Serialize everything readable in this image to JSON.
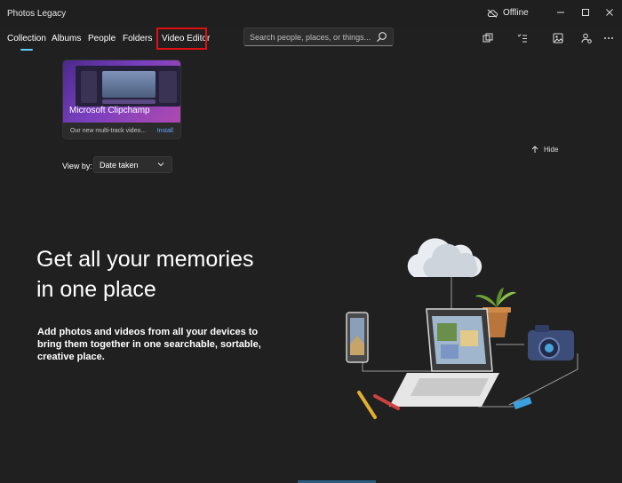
{
  "window": {
    "title": "Photos Legacy",
    "offline_label": "Offline"
  },
  "nav": {
    "tabs": [
      {
        "label": "Collection",
        "active": true
      },
      {
        "label": "Albums"
      },
      {
        "label": "People"
      },
      {
        "label": "Folders"
      },
      {
        "label": "Video Editor",
        "highlighted": true
      }
    ]
  },
  "search": {
    "placeholder": "Search people, places, or things..."
  },
  "toolbar": {
    "icons": [
      "import-icon",
      "select-icon",
      "slideshow-icon",
      "sign-in-icon",
      "more-icon"
    ]
  },
  "promo": {
    "title": "Microsoft Clipchamp",
    "description": "Our new multi-track video...",
    "action": "Install"
  },
  "hide_label": "Hide",
  "view_by": {
    "label": "View by:",
    "value": "Date taken"
  },
  "empty_state": {
    "headline_line1": "Get all your memories",
    "headline_line2": "in one place",
    "body": "Add photos and videos from all your devices to bring them together in one searchable, sortable, creative place."
  },
  "colors": {
    "background": "#202020",
    "accent": "#60cdff",
    "highlight_box": "#e01010",
    "link": "#60a8ff"
  }
}
